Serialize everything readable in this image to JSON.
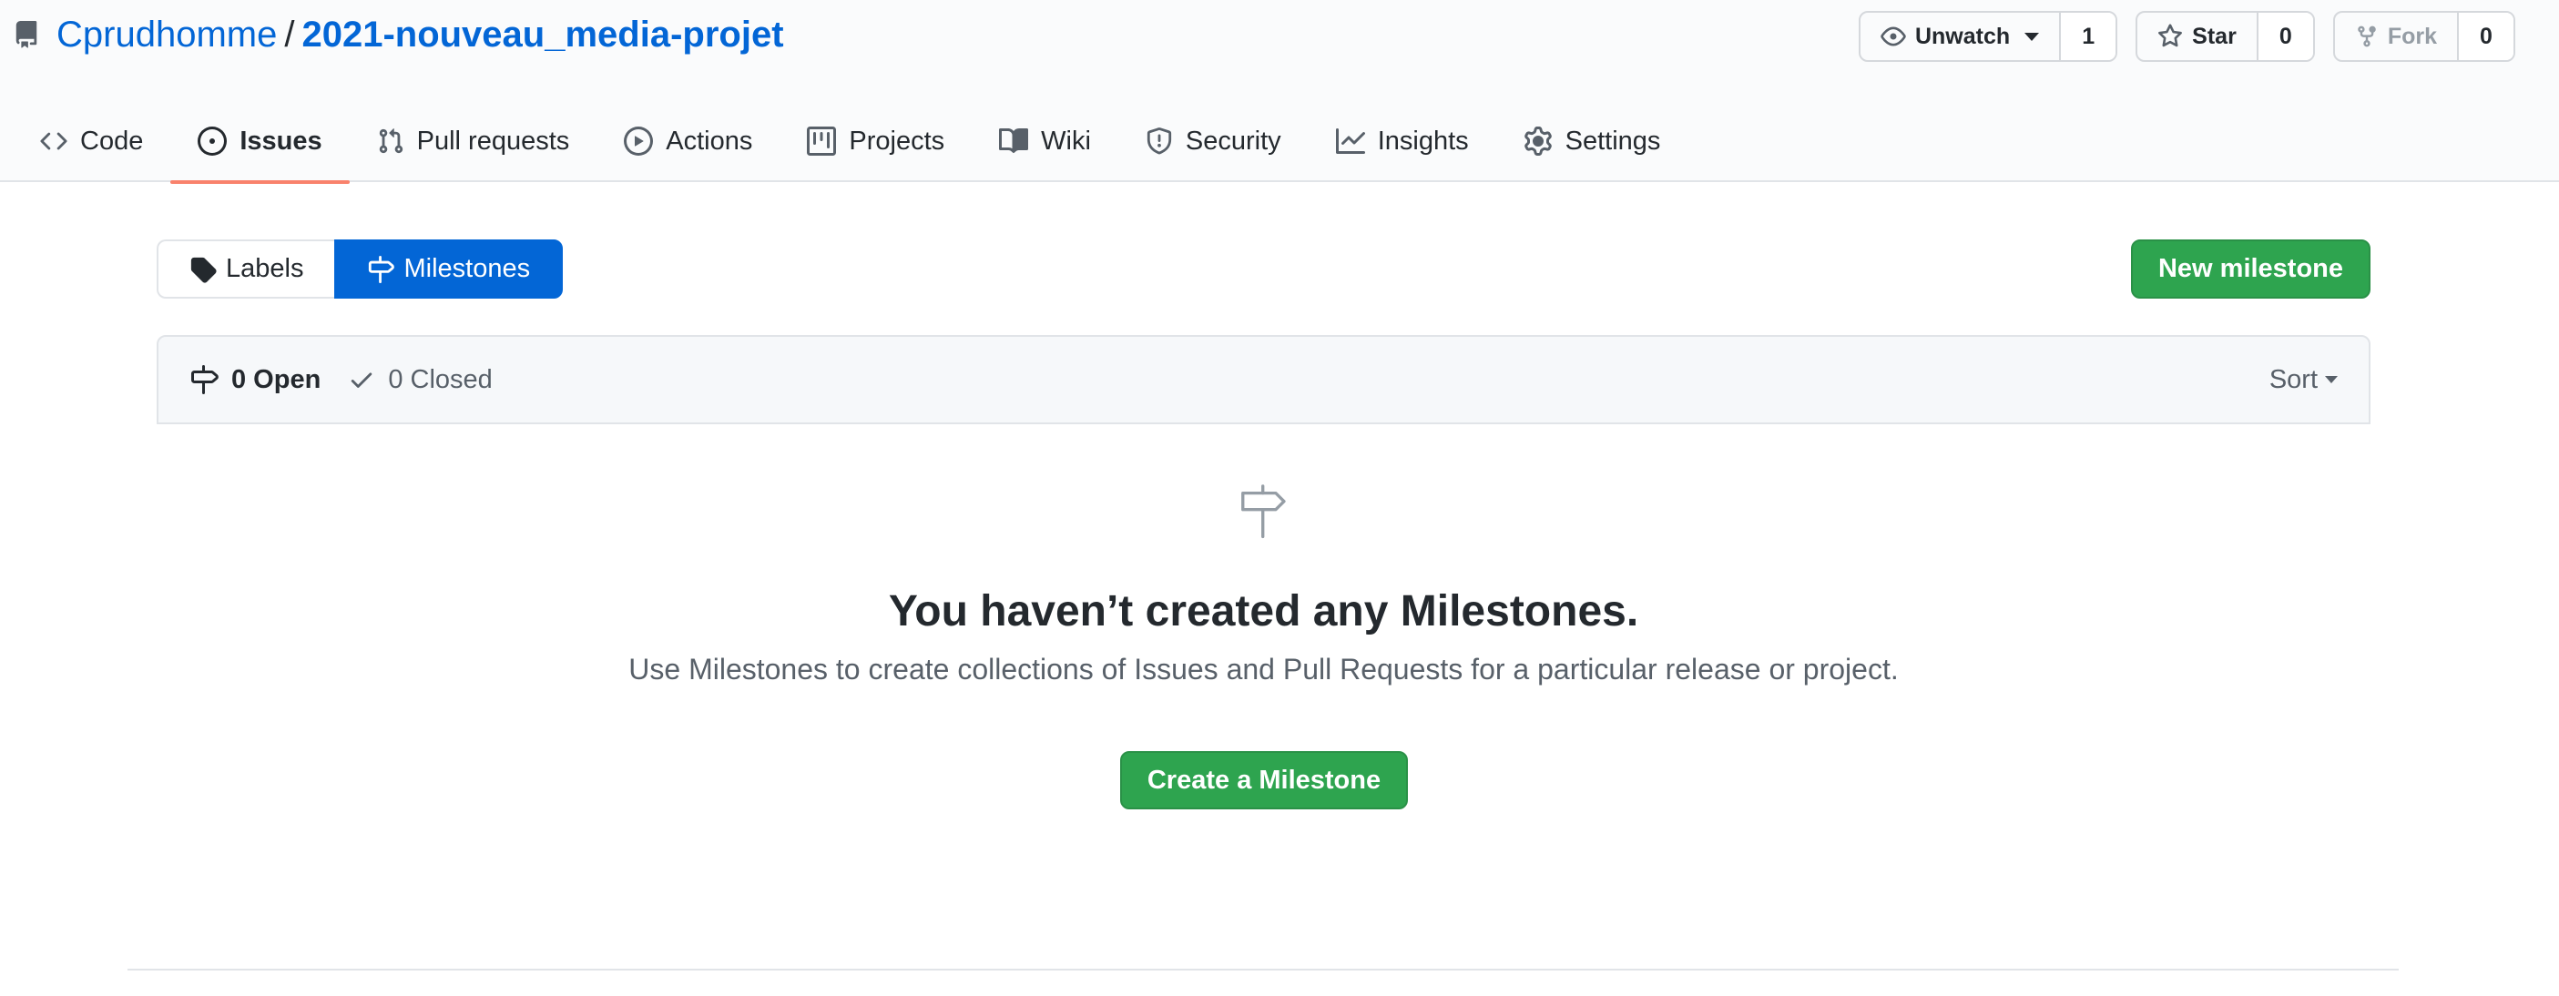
{
  "repo": {
    "owner": "Cprudhomme",
    "separator": "/",
    "name": "2021-nouveau_media-projet"
  },
  "actions": {
    "watch": {
      "label": "Unwatch",
      "count": "1"
    },
    "star": {
      "label": "Star",
      "count": "0"
    },
    "fork": {
      "label": "Fork",
      "count": "0"
    }
  },
  "nav": [
    {
      "label": "Code",
      "icon": "code-icon"
    },
    {
      "label": "Issues",
      "icon": "issue-opened-icon",
      "selected": true
    },
    {
      "label": "Pull requests",
      "icon": "git-pull-request-icon"
    },
    {
      "label": "Actions",
      "icon": "play-icon"
    },
    {
      "label": "Projects",
      "icon": "project-icon"
    },
    {
      "label": "Wiki",
      "icon": "book-icon"
    },
    {
      "label": "Security",
      "icon": "shield-icon"
    },
    {
      "label": "Insights",
      "icon": "graph-icon"
    },
    {
      "label": "Settings",
      "icon": "gear-icon"
    }
  ],
  "subnav": {
    "labels": "Labels",
    "milestones": "Milestones"
  },
  "new_milestone": "New milestone",
  "states": {
    "open": "0 Open",
    "closed": "0 Closed"
  },
  "sort": "Sort",
  "blankslate": {
    "title": "You haven’t created any Milestones.",
    "description": "Use Milestones to create collections of Issues and Pull Requests for a particular release or project.",
    "button": "Create a Milestone"
  },
  "colors": {
    "link": "#0366d6",
    "primary": "#2ea44f",
    "selected_tab_underline": "#f9826c"
  }
}
